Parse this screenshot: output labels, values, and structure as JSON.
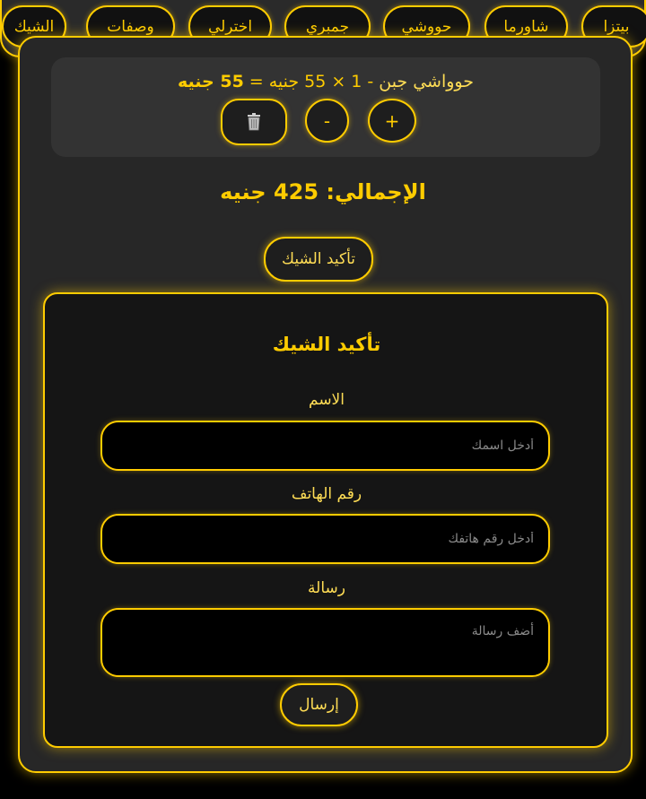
{
  "nav": {
    "items": [
      {
        "label": "الشيك"
      },
      {
        "label": "وصفات"
      },
      {
        "label": "اخترلي"
      },
      {
        "label": "جمبري"
      },
      {
        "label": "حووشي"
      },
      {
        "label": "شاورما"
      },
      {
        "label": "بيتزا"
      }
    ]
  },
  "cart": {
    "item": {
      "name": "حوواشي جبن",
      "sep": "-",
      "quantity": "1",
      "times": "×",
      "unit_price": "55 جنيه",
      "equals": "=",
      "subtotal": "55 جنيه"
    },
    "delete_icon": "trash-icon",
    "minus_label": "-",
    "plus_label": "+"
  },
  "total": {
    "text": "الإجمالي: 425 جنيه"
  },
  "confirm_button": {
    "label": "تأكيد الشيك"
  },
  "form": {
    "title": "تأكيد الشيك",
    "name_label": "الاسم",
    "name_placeholder": "أدخل اسمك",
    "phone_label": "رقم الهاتف",
    "phone_placeholder": "أدخل رقم هاتفك",
    "message_label": "رسالة",
    "message_placeholder": "أضف رسالة",
    "send_label": "إرسال"
  },
  "colors": {
    "accent": "#ffcc00",
    "background": "#000000",
    "panel": "#272727"
  }
}
